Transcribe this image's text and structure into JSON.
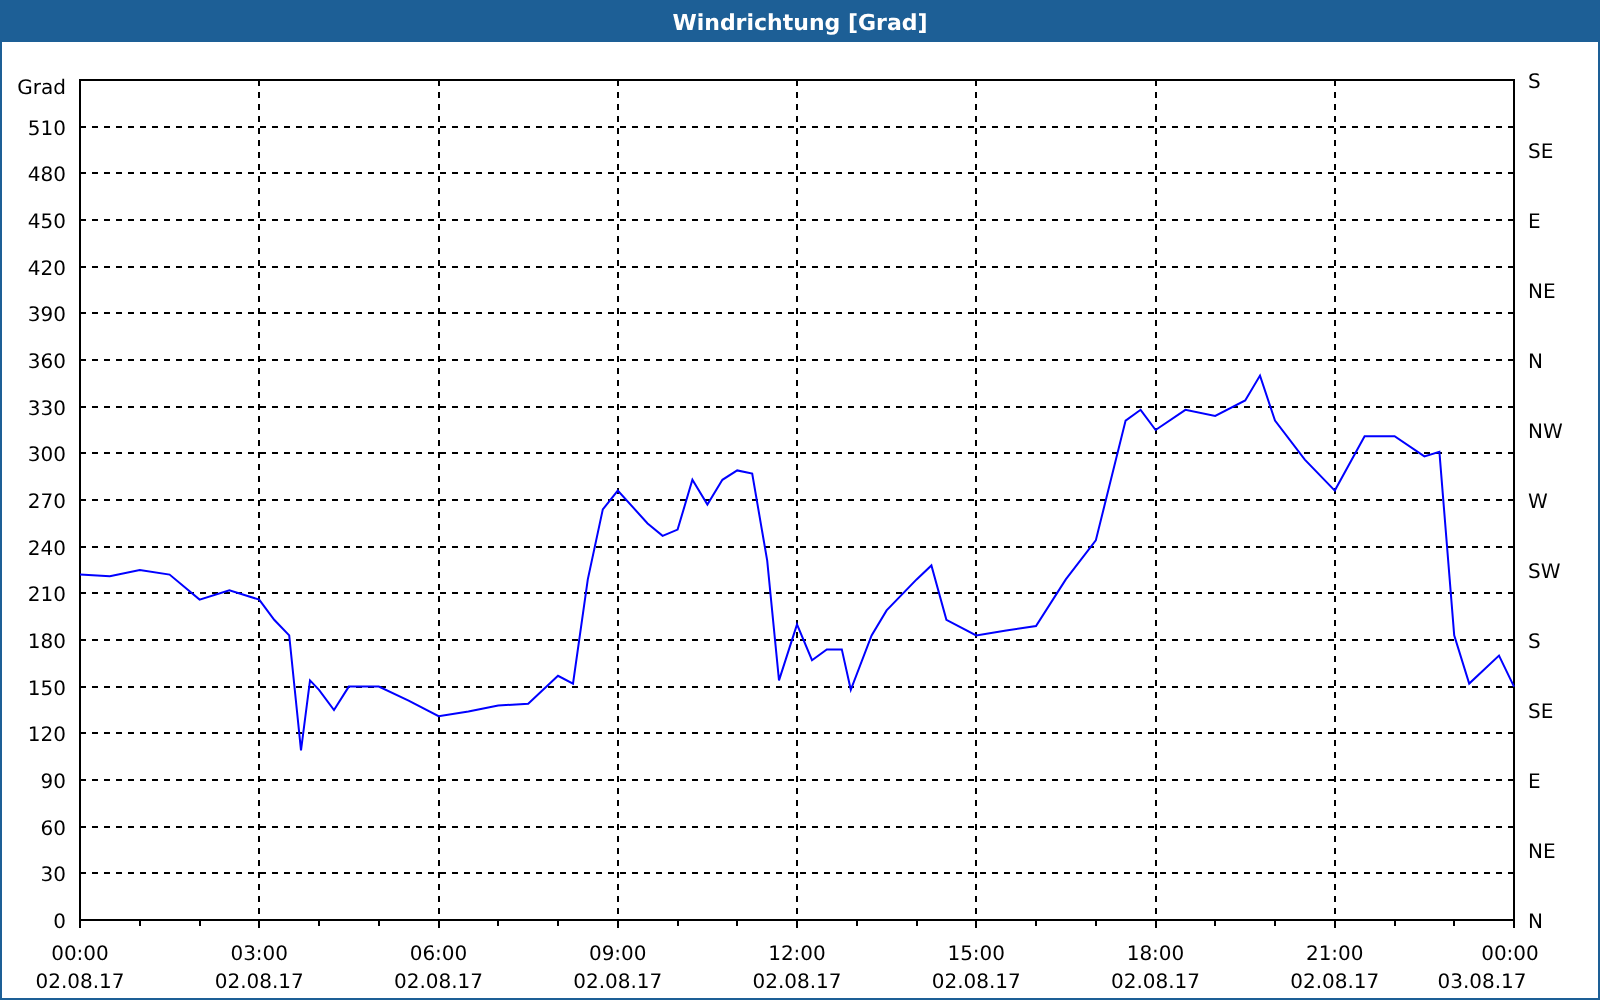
{
  "window": {
    "title": "Windrichtung [Grad]"
  },
  "plot": {
    "xtick_dates": [
      "02.08.17",
      "02.08.17",
      "02.08.17",
      "02.08.17",
      "02.08.17",
      "02.08.17",
      "02.08.17",
      "02.08.17",
      "03.08.17"
    ],
    "right_labels": [
      "S",
      "SE",
      "E",
      "NE",
      "N",
      "NW",
      "W",
      "SW",
      "S",
      "SE",
      "E",
      "NE",
      "N"
    ],
    "chart_data": {
      "type": "line",
      "ylabel": "Grad",
      "grid": true,
      "xlim": [
        0,
        24
      ],
      "ylim": [
        0,
        540
      ],
      "xticks": [
        {
          "value": 0,
          "label": "00:00"
        },
        {
          "value": 3,
          "label": "03:00"
        },
        {
          "value": 6,
          "label": "06:00"
        },
        {
          "value": 9,
          "label": "09:00"
        },
        {
          "value": 12,
          "label": "12:00"
        },
        {
          "value": 15,
          "label": "15:00"
        },
        {
          "value": 18,
          "label": "18:00"
        },
        {
          "value": 21,
          "label": "21:00"
        },
        {
          "value": 24,
          "label": "00:00"
        }
      ],
      "yticks": [
        0,
        30,
        60,
        90,
        120,
        150,
        180,
        210,
        240,
        270,
        300,
        330,
        360,
        390,
        420,
        450,
        480,
        510
      ],
      "x": [
        0,
        0.5,
        1,
        1.5,
        2,
        2.5,
        3,
        3.25,
        3.5,
        3.7,
        3.85,
        4,
        4.25,
        4.5,
        5,
        5.5,
        6,
        6.5,
        7,
        7.5,
        8,
        8.25,
        8.5,
        8.75,
        9,
        9.5,
        9.75,
        10,
        10.25,
        10.5,
        10.75,
        11,
        11.25,
        11.5,
        11.7,
        12,
        12.25,
        12.5,
        12.75,
        12.9,
        13.25,
        13.5,
        14,
        14.25,
        14.5,
        15,
        15.5,
        16,
        16.5,
        17,
        17.5,
        17.75,
        18,
        18.5,
        19,
        19.5,
        19.75,
        20,
        20.5,
        21,
        21.5,
        22,
        22.5,
        22.75,
        23,
        23.25,
        23.5,
        23.75,
        24
      ],
      "series": [
        {
          "color": "#0000ff",
          "values": [
            222,
            221,
            225,
            222,
            206,
            212,
            206,
            193,
            183,
            109,
            154,
            148,
            135,
            150,
            150,
            141,
            131,
            134,
            138,
            139,
            157,
            152,
            219,
            264,
            276,
            255,
            247,
            251,
            283,
            267,
            283,
            289,
            287,
            231,
            154,
            190,
            167,
            174,
            174,
            148,
            183,
            199,
            219,
            228,
            193,
            183,
            186,
            189,
            219,
            244,
            321,
            328,
            315,
            328,
            324,
            334,
            350,
            321,
            296,
            276,
            311,
            311,
            298,
            301,
            183,
            152,
            161,
            170,
            150
          ]
        }
      ]
    }
  }
}
